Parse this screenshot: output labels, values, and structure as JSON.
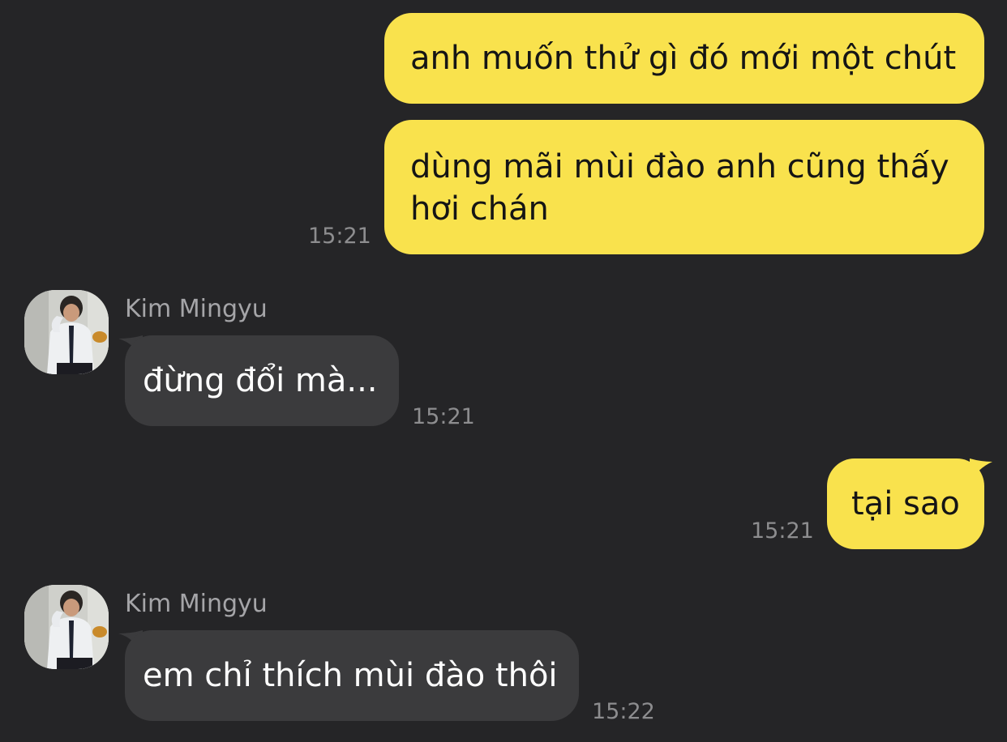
{
  "theme": {
    "background": "#252527",
    "outgoing_bubble": "#f9e24d",
    "incoming_bubble": "#3b3b3d",
    "timestamp_color": "#8d8d8f",
    "sender_color": "#a5a5a8"
  },
  "messages": [
    {
      "direction": "outgoing",
      "text": "anh muốn thử gì đó mới một chút"
    },
    {
      "direction": "outgoing",
      "line1": "dùng mãi mùi đào anh cũng thấy",
      "line2": "hơi chán",
      "time": "15:21"
    },
    {
      "direction": "incoming",
      "sender": "Kim Mingyu",
      "avatar_icon": "profile-photo-avatar",
      "text": "đừng đổi mà...",
      "time": "15:21"
    },
    {
      "direction": "outgoing",
      "text": "tại sao",
      "time": "15:21"
    },
    {
      "direction": "incoming",
      "sender": "Kim Mingyu",
      "avatar_icon": "profile-photo-avatar",
      "text": "em chỉ thích mùi đào thôi",
      "time": "15:22"
    }
  ]
}
